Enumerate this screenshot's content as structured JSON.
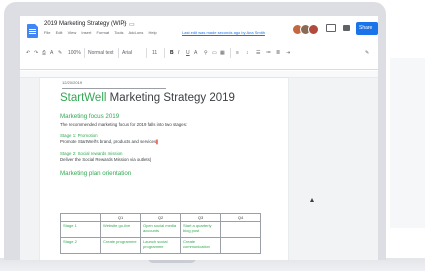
{
  "document": {
    "title": "2019 Marketing Strategy (WIP)",
    "menu": [
      "File",
      "Edit",
      "View",
      "Insert",
      "Format",
      "Tools",
      "Add-ons",
      "Help"
    ],
    "last_edit": "Last edit was made seconds ago by Ana Smith"
  },
  "header": {
    "share_label": "Share"
  },
  "toolbar": {
    "zoom": "100%",
    "style": "Normal text",
    "font": "Arial",
    "font_size": "11"
  },
  "page": {
    "date": "12/20/2019",
    "heading_brand": "StartWell",
    "heading_rest": "Marketing Strategy 2019",
    "focus_heading": "Marketing focus 2019",
    "focus_text": "The recommended marketing focus for 2019 falls into two stages:",
    "stage1_label": "Stage 1: Promotion",
    "stage1_text": "Promote StartWell's brand, products and services",
    "stage2_label": "Stage 2: Social rewards mission",
    "stage2_text": "Deliver the Social Rewards Mission via outlets",
    "plan_heading": "Marketing plan orientation"
  },
  "table": {
    "headers": [
      "",
      "Q1",
      "Q2",
      "Q3",
      "Q4"
    ],
    "rows": [
      [
        "Stage 1",
        "Website go-live",
        "Open social media accounts",
        "Start a quarterly blog post",
        ""
      ],
      [
        "Stage 2",
        "Create programme",
        "Launch social programme",
        "Create communication",
        ""
      ]
    ]
  },
  "colors": {
    "brand_green": "#34a853",
    "accent_blue": "#1a73e8"
  }
}
